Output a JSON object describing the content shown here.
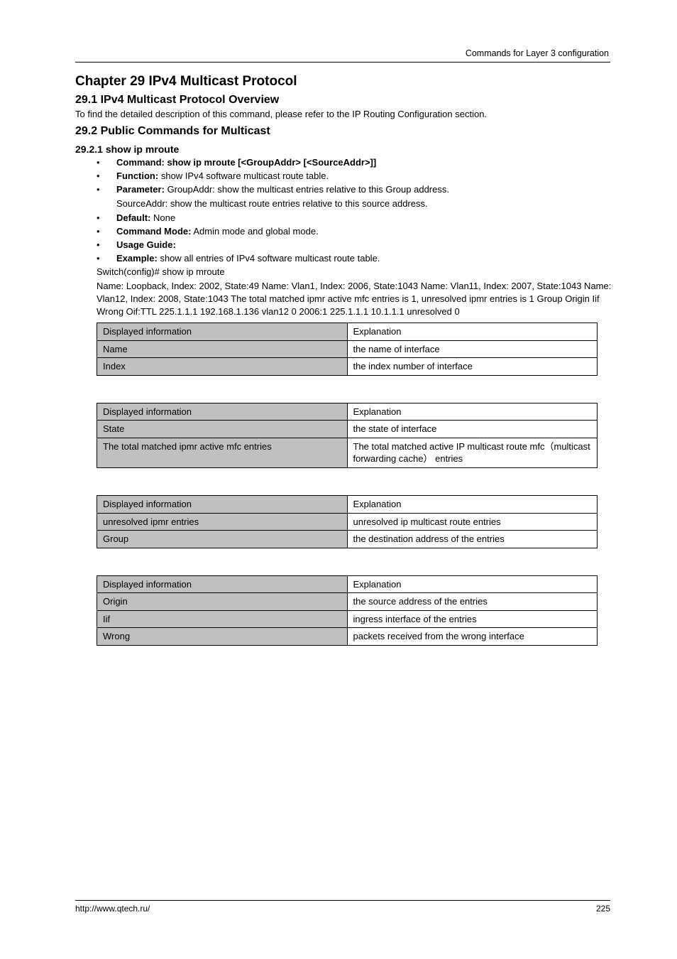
{
  "header": {
    "right_text": "Commands for Layer 3 configuration"
  },
  "section": {
    "chapter_title": "Chapter 29  IPv4 Multicast Protocol",
    "subsection_title": "29.1  IPv4 Multicast Protocol Overview",
    "overview_text": "To find the detailed description of this command, please refer to the IP Routing Configuration section.",
    "public_title": "29.2  Public Commands for Multicast",
    "cmd1": {
      "title": "29.2.1  show ip mroute",
      "label_cmd": "Command: show ip mroute [<GroupAddr> [<SourceAddr>]]",
      "function_label": "Function:",
      "function_text": "show IPv4 software multicast route table.",
      "param_label": "Parameter:",
      "param_text": "GroupAddr: show the multicast entries relative to this Group address.",
      "param_text2": "SourceAddr: show the multicast route entries relative to this source address.",
      "default_label": "Default:",
      "default_text": "None",
      "mode_label": "Command Mode:",
      "mode_text": "Admin mode and global mode.",
      "usage_label": "Usage Guide:",
      "example_label": "Example:",
      "example_text": "show all entries of IPv4 software multicast route table.",
      "cli_text": "Switch(config)# show ip mroute",
      "output_line": "Name: Loopback, Index: 2002, State:49  Name: Vlan1, Index: 2006, State:1043  Name: Vlan11, Index: 2007, State:1043  Name: Vlan12, Index: 2008, State:1043  The total matched ipmr active mfc entries is 1, unresolved ipmr entries is 1  Group  Origin  Iif  Wrong Oif:TTL  225.1.1.1  192.168.1.136  vlan12  0  2006:1  225.1.1.1  10.1.1.1  unresolved  0",
      "tables": [
        {
          "label": "Displayed information",
          "value": "Explanation"
        },
        {
          "label": "Name",
          "value": "the name of interface"
        },
        {
          "label": "Index",
          "value": "the index number of interface"
        },
        {
          "label": "State",
          "value": "the state of interface"
        },
        {
          "label": "The total matched ipmr active mfc entries",
          "value": "The total matched active IP multicast route mfc（multicast forwarding cache） entries"
        },
        {
          "label": "unresolved ipmr entries",
          "value": "unresolved ip multicast route entries"
        },
        {
          "label": "Group",
          "value": "the destination address of the entries"
        },
        {
          "label": "Origin",
          "value": "the source address of the entries"
        },
        {
          "label": "Iif",
          "value": "ingress interface of the entries"
        },
        {
          "label": "Wrong",
          "value": "packets received from the wrong interface"
        }
      ]
    }
  },
  "footer": {
    "left": "http://www.qtech.ru/",
    "right": "225"
  }
}
